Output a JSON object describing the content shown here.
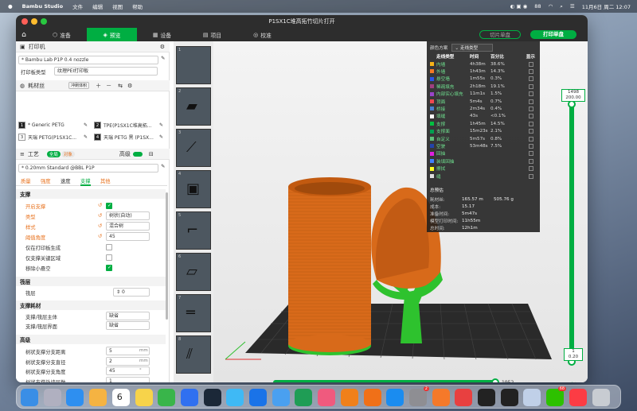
{
  "menubar": {
    "app": "Bambu Studio",
    "items": [
      "文件",
      "编辑",
      "视图",
      "帮助"
    ],
    "battery": "88",
    "clock": "11月6日 周二 12:07"
  },
  "window": {
    "title": "P1SX1C堆高拓竹切片打开"
  },
  "nav": {
    "tabs": [
      "准备",
      "预览",
      "设备",
      "项目",
      "校准"
    ],
    "active": 1,
    "slice_btn": "切片单盘",
    "print_btn": "打印单盘"
  },
  "sidebar": {
    "printer_hdr": "打印机",
    "printer": "* Bambu Lab P1P 0.4 nozzle",
    "plate_label": "打印板类型",
    "plate": "纹理PEI打印板",
    "filament_hdr": "耗材丝",
    "filament_badge": "冲刷体积",
    "filaments": [
      {
        "num": "1",
        "name": "* Generic PETG",
        "color": "#222222"
      },
      {
        "num": "2",
        "name": "TPE(P1SX1C堆高拓...",
        "color": "#222222"
      },
      {
        "num": "3",
        "name": "天瑞 PETG(P1SX1C...",
        "color": "#ffffff"
      },
      {
        "num": "4",
        "name": "天瑞 PETG 黑 (P1SX...",
        "color": "#222222"
      }
    ],
    "process_hdr": "工艺",
    "process_toggle_a": "全局",
    "process_toggle_b": "对象",
    "advanced": "高级",
    "process": "* 0.20mm Standard @BBL P1P",
    "subtabs": [
      "质量",
      "强度",
      "速度",
      "支撑",
      "其他"
    ],
    "support_hdr": "支撑",
    "rows": [
      {
        "label": "开启支撑",
        "type": "check",
        "on": true,
        "orange": true
      },
      {
        "label": "类型",
        "value": "树状(自动)",
        "orange": true
      },
      {
        "label": "样式",
        "value": "混合树",
        "orange": true
      },
      {
        "label": "阈值角度",
        "value": "45",
        "orange": true
      },
      {
        "label": "仅在打印板生成",
        "type": "check",
        "on": false
      },
      {
        "label": "仅支撑关键区域",
        "type": "check",
        "on": false
      },
      {
        "label": "移除小悬空",
        "type": "check",
        "on": true
      }
    ],
    "raft_hdr": "筏层",
    "raft_label": "筏层",
    "raft_value": "0",
    "supmat_hdr": "支撑耗材",
    "supmat": [
      {
        "label": "支撑/筏层主体",
        "value": "缺省"
      },
      {
        "label": "支撑/筏层界面",
        "value": "缺省"
      }
    ],
    "adv_hdr": "高级",
    "adv": [
      {
        "label": "树状支撑分支距离",
        "value": "5",
        "unit": "mm"
      },
      {
        "label": "树状支撑分支直径",
        "value": "2",
        "unit": "mm"
      },
      {
        "label": "树状支撑分支角度",
        "value": "45",
        "unit": "°"
      },
      {
        "label": "树状支撑外墙层数",
        "value": "1",
        "unit": ""
      },
      {
        "label": "树状支撑墙边宽度",
        "value": "0",
        "unit": "mm"
      }
    ]
  },
  "legend": {
    "scheme_label": "颜色方案",
    "scheme": "走线类型",
    "cols": [
      "走线类型",
      "时间",
      "百分比",
      "显示"
    ],
    "rows": [
      {
        "name": "内墙",
        "time": "4h38m",
        "pct": "38.6%",
        "color": "#f7b318"
      },
      {
        "name": "外墙",
        "time": "1h43m",
        "pct": "14.3%",
        "color": "#f57a24"
      },
      {
        "name": "悬空墙",
        "time": "1m55s",
        "pct": "0.3%",
        "color": "#2b55e6"
      },
      {
        "name": "稀疏填充",
        "time": "2h18m",
        "pct": "19.1%",
        "color": "#a04080"
      },
      {
        "name": "内部实心填充",
        "time": "11m1s",
        "pct": "1.5%",
        "color": "#9a45c9"
      },
      {
        "name": "顶面",
        "time": "5m4s",
        "pct": "0.7%",
        "color": "#f0484f"
      },
      {
        "name": "桥接",
        "time": "2m34s",
        "pct": "0.4%",
        "color": "#4a7fd0"
      },
      {
        "name": "填缝",
        "time": "43s",
        "pct": "<0.1%",
        "color": "#ffffff"
      },
      {
        "name": "支撑",
        "time": "1h45m",
        "pct": "14.5%",
        "color": "#00c040"
      },
      {
        "name": "支撑面",
        "time": "15m23s",
        "pct": "2.1%",
        "color": "#00a050"
      },
      {
        "name": "自定义",
        "time": "5m57s",
        "pct": "0.8%",
        "color": "#5ec07a"
      },
      {
        "name": "空驶",
        "time": "53m48s",
        "pct": "7.5%",
        "color": "#2244aa"
      },
      {
        "name": "回抽",
        "time": "",
        "pct": "",
        "color": "#e020e0"
      },
      {
        "name": "装填回抽",
        "time": "",
        "pct": "",
        "color": "#4080ff"
      },
      {
        "name": "擦拭",
        "time": "",
        "pct": "",
        "color": "#ffff20"
      },
      {
        "name": "缝",
        "time": "",
        "pct": "",
        "color": "#e0e0e0"
      }
    ],
    "summary_hdr": "总预估",
    "summary": [
      {
        "k": "耗材丝:",
        "v": "165.57 m",
        "v2": "505.76 g"
      },
      {
        "k": "成本:",
        "v": "15.17",
        "v2": ""
      },
      {
        "k": "准备时间:",
        "v": "5m47s",
        "v2": ""
      },
      {
        "k": "模型打印时间:",
        "v": "11h55m",
        "v2": ""
      },
      {
        "k": "总时间:",
        "v": "12h1m",
        "v2": ""
      }
    ]
  },
  "layer_slider": {
    "top_layer": "1498",
    "top_height": "200.00",
    "bottom_layer": "1",
    "bottom_height": "0.20"
  },
  "move_slider": {
    "value": "1952"
  },
  "dock": {
    "calendar_day": "6",
    "badge_a": "2",
    "badge_b": "68"
  }
}
